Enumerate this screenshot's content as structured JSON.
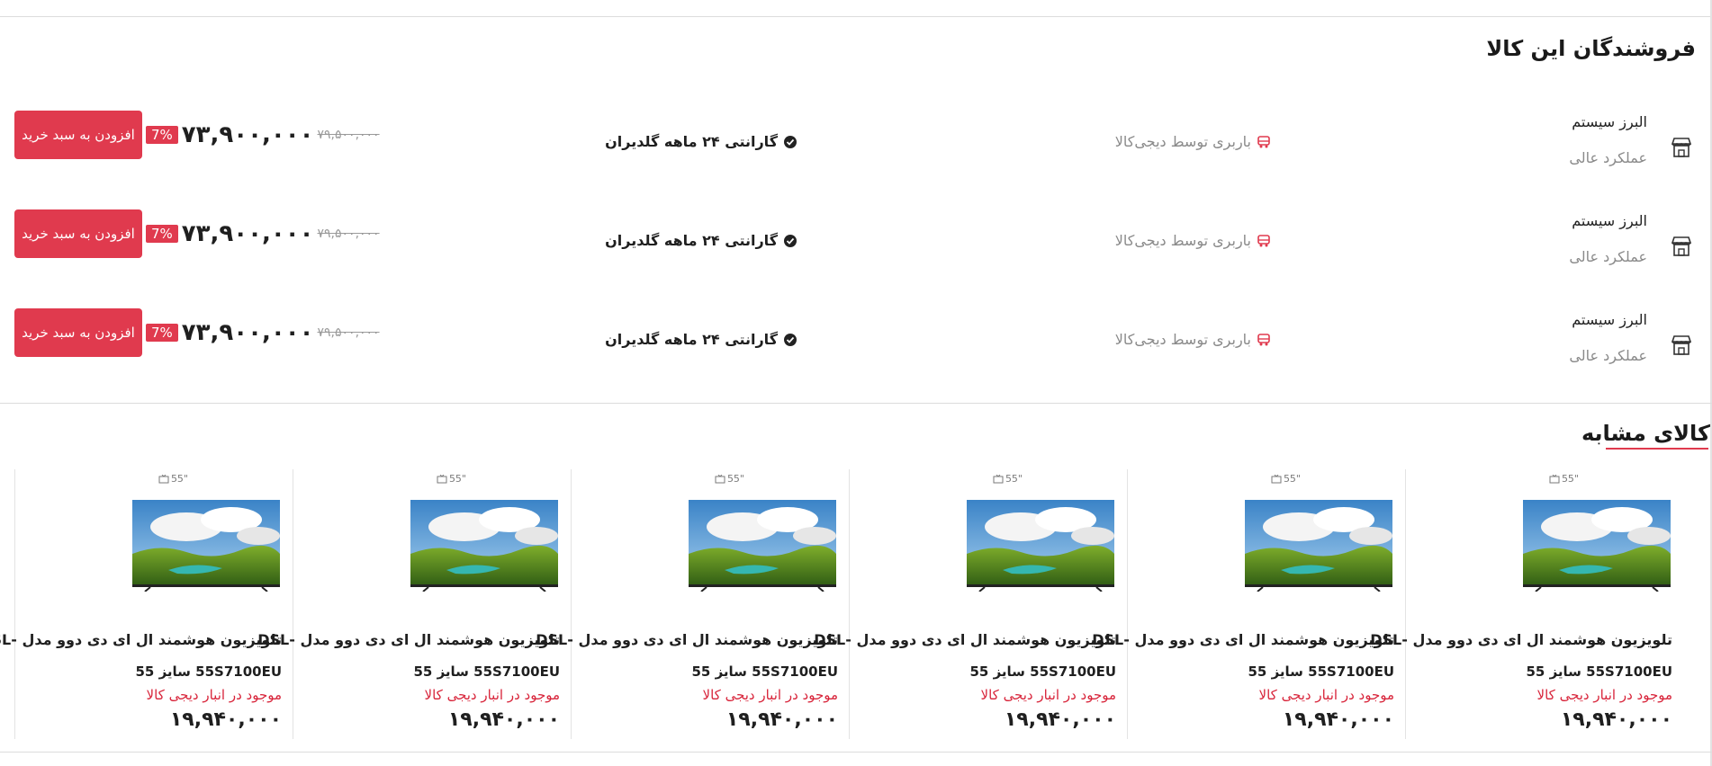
{
  "sellers_section": {
    "title": "فروشندگان این کالا",
    "rows": [
      {
        "seller_name": "البرز سیستم",
        "rating": "عملکرد عالی",
        "shipping": "باربری توسط دیجی‌کالا",
        "warranty": "گارانتی ۲۴ ماهه گلدیران",
        "old_price": "۷۹,۵۰۰,۰۰۰",
        "price": "۷۳,۹۰۰,۰۰۰",
        "discount": "7%",
        "button_label": "افزودن به سبد خرید"
      },
      {
        "seller_name": "البرز سیستم",
        "rating": "عملکرد عالی",
        "shipping": "باربری توسط دیجی‌کالا",
        "warranty": "گارانتی ۲۴ ماهه گلدیران",
        "old_price": "۷۹,۵۰۰,۰۰۰",
        "price": "۷۳,۹۰۰,۰۰۰",
        "discount": "7%",
        "button_label": "افزودن به سبد خرید"
      },
      {
        "seller_name": "البرز سیستم",
        "rating": "عملکرد عالی",
        "shipping": "باربری توسط دیجی‌کالا",
        "warranty": "گارانتی ۲۴ ماهه گلدیران",
        "old_price": "۷۹,۵۰۰,۰۰۰",
        "price": "۷۳,۹۰۰,۰۰۰",
        "discount": "7%",
        "button_label": "افزودن به سبد خرید"
      }
    ]
  },
  "similar_section": {
    "title": "کالای مشابه",
    "products": [
      {
        "size": "55\"",
        "name": "تلویزیون هوشمند ال ای دی دوو مدل -DSL",
        "model": "55S7100EU سایز 55",
        "stock": "موجود در انبار دیجی کالا",
        "price": "۱۹,۹۴۰,۰۰۰"
      },
      {
        "size": "55\"",
        "name": "تلویزیون هوشمند ال ای دی دوو مدل -DSL",
        "model": "55S7100EU سایز 55",
        "stock": "موجود در انبار دیجی کالا",
        "price": "۱۹,۹۴۰,۰۰۰"
      },
      {
        "size": "55\"",
        "name": "تلویزیون هوشمند ال ای دی دوو مدل -DSL",
        "model": "55S7100EU سایز 55",
        "stock": "موجود در انبار دیجی کالا",
        "price": "۱۹,۹۴۰,۰۰۰"
      },
      {
        "size": "55\"",
        "name": "تلویزیون هوشمند ال ای دی دوو مدل -DSL",
        "model": "55S7100EU سایز 55",
        "stock": "موجود در انبار دیجی کالا",
        "price": "۱۹,۹۴۰,۰۰۰"
      },
      {
        "size": "55\"",
        "name": "تلویزیون هوشمند ال ای دی دوو مدل -DSL",
        "model": "55S7100EU سایز 55",
        "stock": "موجود در انبار دیجی کالا",
        "price": "۱۹,۹۴۰,۰۰۰"
      },
      {
        "size": "55\"",
        "name": "تلویزیون هوشمند ال ای دی دوو مدل -DSL",
        "model": "55S7100EU سایز 55",
        "stock": "موجود در انبار دیجی کالا",
        "price": "۱۹,۹۴۰,۰۰۰"
      }
    ]
  },
  "icons": {
    "store": "store-icon",
    "truck": "truck-icon",
    "warranty": "shield-check-icon",
    "tv": "tv-icon"
  },
  "colors": {
    "accent": "#e03a4e",
    "stock": "#d8243a",
    "muted": "#8a8a8a"
  }
}
